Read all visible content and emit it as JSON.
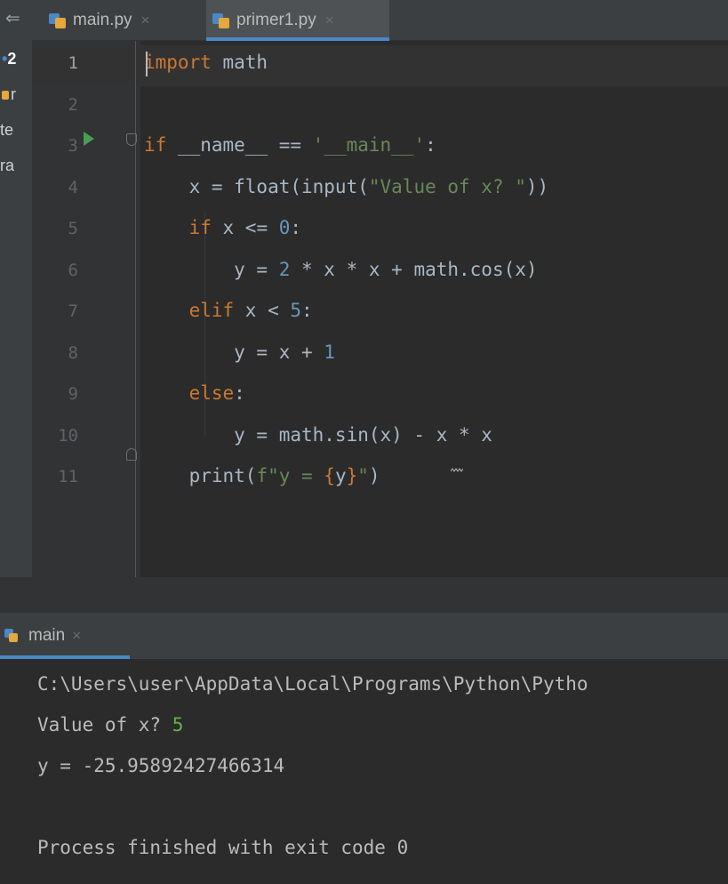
{
  "editor": {
    "tabs": [
      {
        "name": "main.py",
        "active": false
      },
      {
        "name": "primer1.py",
        "active": true
      }
    ],
    "close_glyph": "×",
    "lines": [
      {
        "n": "1",
        "tokens": [
          {
            "t": "import",
            "c": "kw"
          },
          {
            "t": " math",
            "c": ""
          }
        ]
      },
      {
        "n": "2",
        "tokens": []
      },
      {
        "n": "3",
        "tokens": [
          {
            "t": "if",
            "c": "kw"
          },
          {
            "t": " __name__ == ",
            "c": ""
          },
          {
            "t": "'__main__'",
            "c": "str"
          },
          {
            "t": ":",
            "c": ""
          }
        ]
      },
      {
        "n": "4",
        "tokens": [
          {
            "t": "    x = float(input(",
            "c": ""
          },
          {
            "t": "\"Value of x? \"",
            "c": "str"
          },
          {
            "t": "))",
            "c": ""
          }
        ]
      },
      {
        "n": "5",
        "tokens": [
          {
            "t": "    ",
            "c": ""
          },
          {
            "t": "if",
            "c": "kw"
          },
          {
            "t": " x <= ",
            "c": ""
          },
          {
            "t": "0",
            "c": "num"
          },
          {
            "t": ":",
            "c": ""
          }
        ]
      },
      {
        "n": "6",
        "tokens": [
          {
            "t": "        y = ",
            "c": ""
          },
          {
            "t": "2",
            "c": "num"
          },
          {
            "t": " * x * x + math.cos(x)",
            "c": ""
          }
        ]
      },
      {
        "n": "7",
        "tokens": [
          {
            "t": "    ",
            "c": ""
          },
          {
            "t": "elif",
            "c": "kw"
          },
          {
            "t": " x < ",
            "c": ""
          },
          {
            "t": "5",
            "c": "num"
          },
          {
            "t": ":",
            "c": ""
          }
        ]
      },
      {
        "n": "8",
        "tokens": [
          {
            "t": "        y = x + ",
            "c": ""
          },
          {
            "t": "1",
            "c": "num"
          }
        ]
      },
      {
        "n": "9",
        "tokens": [
          {
            "t": "    ",
            "c": ""
          },
          {
            "t": "else",
            "c": "kw"
          },
          {
            "t": ":",
            "c": ""
          }
        ]
      },
      {
        "n": "10",
        "tokens": [
          {
            "t": "        y = math.sin(x) - x * x",
            "c": ""
          }
        ]
      },
      {
        "n": "11",
        "tokens": [
          {
            "t": "    print(",
            "c": ""
          },
          {
            "t": "f\"y = ",
            "c": "str"
          },
          {
            "t": "{",
            "c": "brace"
          },
          {
            "t": "y",
            "c": ""
          },
          {
            "t": "}",
            "c": "brace"
          },
          {
            "t": "\"",
            "c": "str"
          },
          {
            "t": ")",
            "c": ""
          }
        ]
      }
    ]
  },
  "project_panel": {
    "items": [
      "2",
      "r",
      "te",
      "ra"
    ]
  },
  "run_panel": {
    "tab_label": "main",
    "output": {
      "command": "C:\\Users\\user\\AppData\\Local\\Programs\\Python\\Pytho",
      "prompt": "Value of x? ",
      "user_input": "5",
      "result": "y = -25.95892427466314",
      "blank": "",
      "exit": "Process finished with exit code 0"
    }
  },
  "colors": {
    "editor_bg": "#2b2b2b",
    "keyword": "#cc7832",
    "string": "#6a8759",
    "number": "#6897bb",
    "text": "#a9b7c6",
    "run_icon": "#499c54",
    "accent": "#4a88c7",
    "user_input": "#62b543"
  },
  "icons": {
    "file_icon": "python-file-icon",
    "run_gutter_icon": "run-play-icon"
  }
}
